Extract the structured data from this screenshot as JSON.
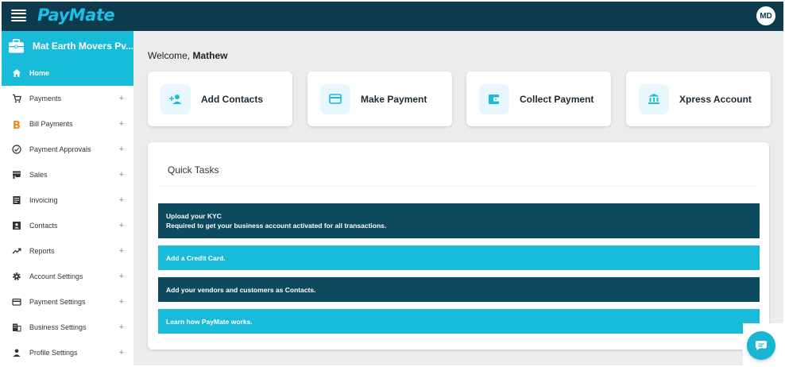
{
  "app": {
    "brand": "PayMate",
    "avatar_initials": "MD",
    "accent": "#18bcd8",
    "header_bg": "#0d3a4c"
  },
  "sidebar": {
    "org_name": "Mat Earth Movers Pv...",
    "items": [
      {
        "label": "Home",
        "icon": "home-icon",
        "active": true
      },
      {
        "label": "Payments",
        "icon": "cart-icon",
        "expand": "+"
      },
      {
        "label": "Bill Payments",
        "icon": "bill-icon",
        "expand": "+"
      },
      {
        "label": "Payment Approvals",
        "icon": "check-circle-icon",
        "expand": "+"
      },
      {
        "label": "Sales",
        "icon": "store-icon",
        "expand": "+"
      },
      {
        "label": "Invoicing",
        "icon": "document-icon",
        "expand": "+"
      },
      {
        "label": "Contacts",
        "icon": "contact-card-icon",
        "expand": "+"
      },
      {
        "label": "Reports",
        "icon": "trending-icon",
        "expand": "+"
      },
      {
        "label": "Account Settings",
        "icon": "gear-icon",
        "expand": "+"
      },
      {
        "label": "Payment Settings",
        "icon": "credit-card-icon",
        "expand": "+"
      },
      {
        "label": "Business Settings",
        "icon": "building-icon",
        "expand": "+"
      },
      {
        "label": "Profile Settings",
        "icon": "person-icon",
        "expand": "+"
      }
    ]
  },
  "main": {
    "welcome_prefix": "Welcome,",
    "user_name": "Mathew",
    "cards": [
      {
        "label": "Add Contacts",
        "icon": "add-person-icon"
      },
      {
        "label": "Make Payment",
        "icon": "card-icon"
      },
      {
        "label": "Collect Payment",
        "icon": "wallet-icon"
      },
      {
        "label": "Xpress Account",
        "icon": "bank-icon"
      }
    ],
    "quick_tasks": {
      "title": "Quick Tasks",
      "items": [
        {
          "line1": "Upload your KYC",
          "line2": "Required to get your business account activated for all transactions."
        },
        {
          "line1": "Add a Credit Card."
        },
        {
          "line1": "Add your vendors and customers as Contacts."
        },
        {
          "line1": "Learn how PayMate works."
        }
      ]
    }
  }
}
